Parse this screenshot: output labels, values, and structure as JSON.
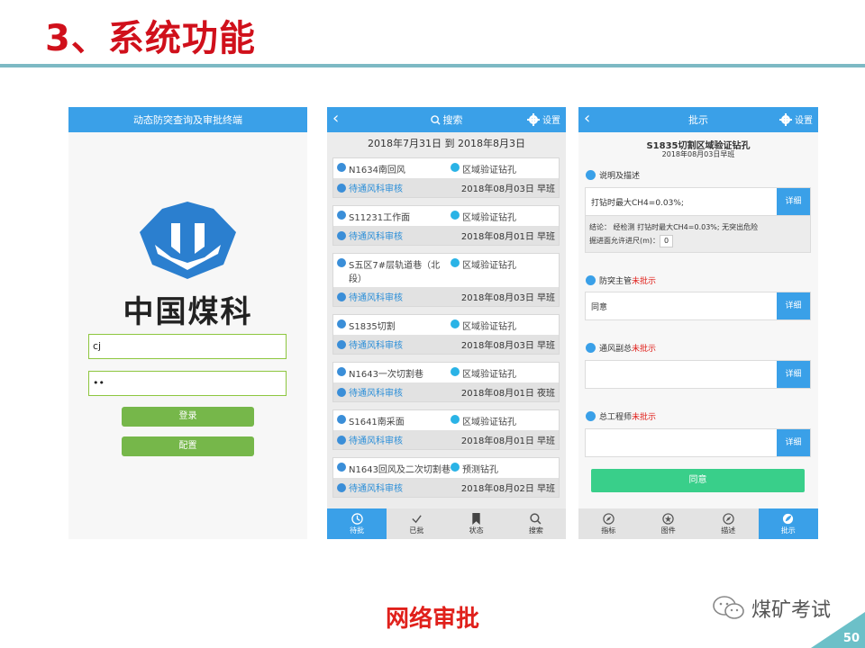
{
  "slide": {
    "title": "3、系统功能",
    "caption": "网络审批",
    "watermark": "煤矿考试",
    "page_number": "50"
  },
  "login": {
    "header": "动态防突查询及审批终端",
    "brand": "中国煤科",
    "username_value": "cj",
    "password_value": "••",
    "login_label": "登录",
    "config_label": "配置"
  },
  "list_screen": {
    "header": "搜索",
    "settings_label": "设置",
    "date_range": "2018年7月31日 到 2018年8月3日",
    "items": [
      {
        "name": "N1634南回风",
        "type": "区域验证钻孔",
        "status": "待通风科审核",
        "date": "2018年08月03日 早班"
      },
      {
        "name": "S11231工作面",
        "type": "区域验证钻孔",
        "status": "待通风科审核",
        "date": "2018年08月01日 早班"
      },
      {
        "name": "S五区7#层轨道巷（北段）",
        "type": "区域验证钻孔",
        "status": "待通风科审核",
        "date": "2018年08月03日 早班"
      },
      {
        "name": "S1835切割",
        "type": "区域验证钻孔",
        "status": "待通风科审核",
        "date": "2018年08月03日 早班"
      },
      {
        "name": "N1643一次切割巷",
        "type": "区域验证钻孔",
        "status": "待通风科审核",
        "date": "2018年08月01日 夜班"
      },
      {
        "name": "S1641南采面",
        "type": "区域验证钻孔",
        "status": "待通风科审核",
        "date": "2018年08月01日 早班"
      },
      {
        "name": "N1643回风及二次切割巷",
        "type": "预测钻孔",
        "status": "待通风科审核",
        "date": "2018年08月02日 早班"
      }
    ],
    "tabs": [
      "待批",
      "已批",
      "状态",
      "搜索"
    ]
  },
  "approve_screen": {
    "header": "批示",
    "settings_label": "设置",
    "title": "S1835切割区域验证钻孔",
    "subtitle": "2018年08月03日早班",
    "desc_label": "说明及描述",
    "desc_value": "打钻时最大CH4=0.03%;",
    "detail_label": "详细",
    "conclusion_text": "结论： 经检测 打钻时最大CH4=0.03%; 无突出危险",
    "allowed_label": "掘进面允许进尺(m)：",
    "allowed_value": "0",
    "sections": [
      {
        "role": "防突主管",
        "state": "未批示",
        "value": "同意"
      },
      {
        "role": "通风副总",
        "state": "未批示",
        "value": ""
      },
      {
        "role": "总工程师",
        "state": "未批示",
        "value": ""
      }
    ],
    "agree_label": "同意",
    "tabs": [
      "指标",
      "图件",
      "描述",
      "批示"
    ]
  }
}
